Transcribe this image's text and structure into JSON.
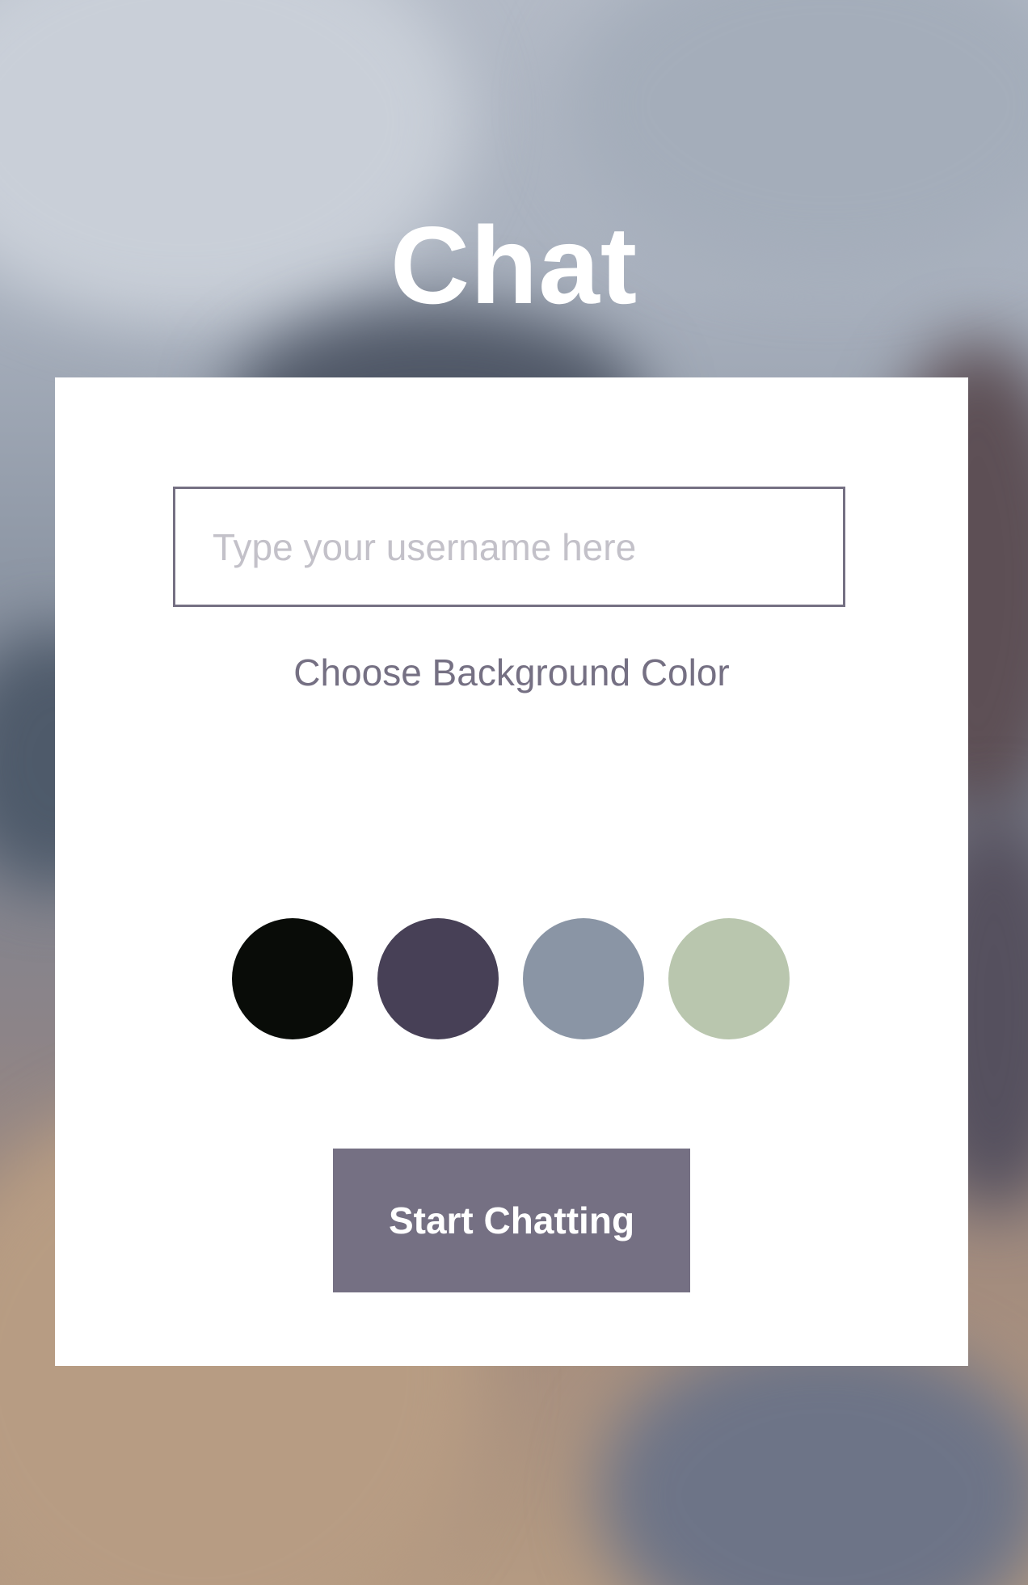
{
  "app": {
    "title": "Chat"
  },
  "start_form": {
    "username": {
      "value": "",
      "placeholder": "Type your username here"
    },
    "color_label": "Choose Background Color",
    "colors": [
      {
        "name": "black",
        "hex": "#090C08"
      },
      {
        "name": "purple",
        "hex": "#474056"
      },
      {
        "name": "gray-blue",
        "hex": "#8A95A5"
      },
      {
        "name": "sage-green",
        "hex": "#B9C6AE"
      }
    ],
    "start_button_label": "Start Chatting"
  },
  "theme": {
    "accent": "#757083",
    "card_background": "#FFFFFF",
    "title_color": "#FFFFFF"
  }
}
